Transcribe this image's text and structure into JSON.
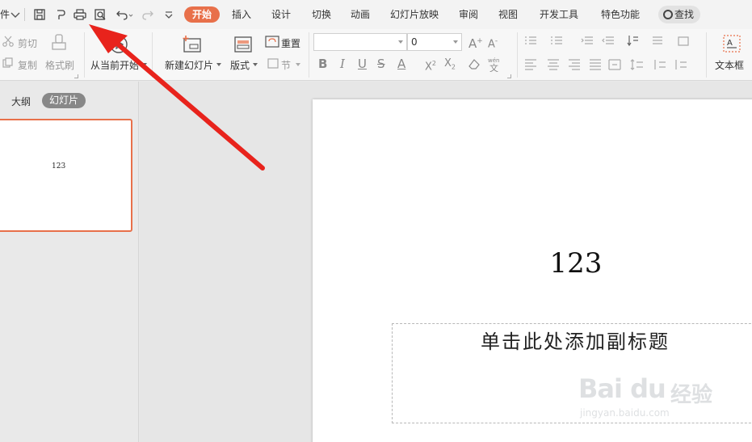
{
  "tabbar": {
    "file_menu_fragment": "件",
    "tabs": [
      "开始",
      "插入",
      "设计",
      "切换",
      "动画",
      "幻灯片放映",
      "审阅",
      "视图",
      "开发工具",
      "特色功能"
    ],
    "search_label": "查找"
  },
  "ribbon": {
    "cut_label": "剪切",
    "copy_label": "复制",
    "format_painter_label": "格式刷",
    "play_from_current_label": "从当前开始",
    "new_slide_label": "新建幻灯片",
    "layout_label": "版式",
    "reset_label": "重置",
    "section_label": "节",
    "font_size_value": "0",
    "textbox_label": "文本框"
  },
  "left_panel": {
    "outline_tab": "大纲",
    "slides_tab": "幻灯片",
    "thumbnail_text": "123"
  },
  "slide": {
    "title": "123",
    "subtitle_placeholder": "单击此处添加副标题"
  },
  "watermark": {
    "logo": "Bai du",
    "cn": "经验",
    "url": "jingyan.baidu.com"
  },
  "colors": {
    "accent": "#e8704a",
    "arrow": "#e8231c"
  }
}
